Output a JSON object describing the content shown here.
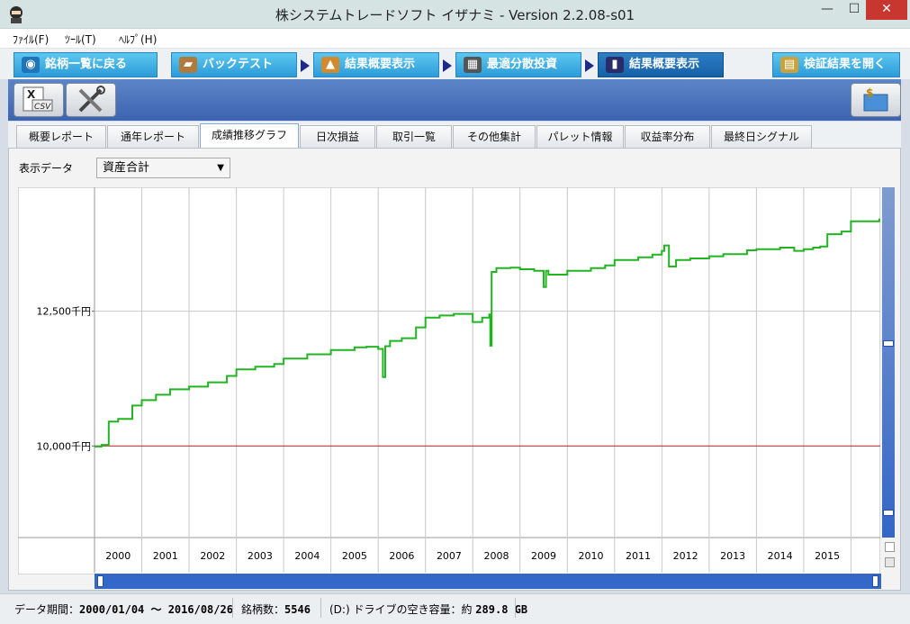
{
  "window": {
    "title": "株システムトレードソフト イザナミ - Version 2.2.08-s01",
    "minimize": "—",
    "maximize": "☐",
    "close": "✕"
  },
  "menu": [
    "ﾌｧｲﾙ(F)",
    "ﾂｰﾙ(T)",
    "ﾍﾙﾌﾟ(H)"
  ],
  "nav": {
    "items": [
      {
        "label": "銘柄一覧に戻る",
        "icon": "eye-icon"
      },
      {
        "label": "バックテスト",
        "icon": "bag-icon"
      },
      {
        "label": "結果概要表示",
        "icon": "hand-chart-icon"
      },
      {
        "label": "最適分散投資",
        "icon": "calculator-icon"
      },
      {
        "label": "結果概要表示",
        "icon": "bar-chart-icon",
        "active": true
      },
      {
        "label": "検証結果を開く",
        "icon": "open-folder-icon"
      }
    ]
  },
  "toolbar": {
    "csv_label": "CSV",
    "tools_icon": "tools-icon",
    "money_icon": "money-box-icon"
  },
  "subtabs": [
    "概要レポート",
    "通年レポート",
    "成績推移グラフ",
    "日次損益",
    "取引一覧",
    "その他集計",
    "パレット情報",
    "収益率分布",
    "最終日シグナル"
  ],
  "active_subtab": "成績推移グラフ",
  "display": {
    "label": "表示データ",
    "selected": "資産合計"
  },
  "chart_data": {
    "type": "line",
    "y_labels": [
      "12,500千円",
      "10,000千円"
    ],
    "y_ticks": [
      12500,
      10000
    ],
    "x_labels": [
      "2000",
      "2001",
      "2002",
      "2003",
      "2004",
      "2005",
      "2006",
      "2007",
      "2008",
      "2009",
      "2010",
      "2011",
      "2012",
      "2013",
      "2014",
      "2015"
    ],
    "baseline": 10000,
    "ylim": [
      8300,
      14800
    ],
    "series": [
      {
        "color": "#22b422",
        "x": [
          2000.0,
          2000.15,
          2000.3,
          2000.5,
          2000.8,
          2001.0,
          2001.3,
          2001.6,
          2002.0,
          2002.4,
          2002.8,
          2003.0,
          2003.4,
          2003.8,
          2004.0,
          2004.5,
          2005.0,
          2005.5,
          2005.75,
          2006.0,
          2006.1,
          2006.15,
          2006.25,
          2006.5,
          2006.8,
          2007.0,
          2007.3,
          2007.6,
          2008.0,
          2008.2,
          2008.35,
          2008.37,
          2008.4,
          2008.5,
          2008.8,
          2009.0,
          2009.3,
          2009.5,
          2009.55,
          2009.6,
          2010.0,
          2010.5,
          2010.8,
          2011.0,
          2011.5,
          2011.8,
          2012.0,
          2012.05,
          2012.15,
          2012.3,
          2012.6,
          2013.0,
          2013.3,
          2013.8,
          2014.0,
          2014.5,
          2014.8,
          2015.0,
          2015.2,
          2015.35,
          2015.5,
          2015.8,
          2016.0,
          2016.6
        ],
        "y": [
          9990,
          10020,
          10450,
          10500,
          10750,
          10850,
          10950,
          11050,
          11100,
          11180,
          11300,
          11420,
          11470,
          11520,
          11620,
          11700,
          11780,
          11830,
          11840,
          11800,
          11280,
          11850,
          11950,
          12000,
          12200,
          12380,
          12420,
          12450,
          12300,
          12380,
          12440,
          11860,
          13230,
          13300,
          13310,
          13280,
          13250,
          12950,
          13250,
          13180,
          13250,
          13300,
          13350,
          13450,
          13500,
          13550,
          13620,
          13720,
          13330,
          13450,
          13480,
          13520,
          13560,
          13630,
          13650,
          13680,
          13620,
          13650,
          13680,
          13700,
          13930,
          13980,
          14170,
          14220
        ]
      }
    ]
  },
  "status": {
    "period_label": "データ期間：",
    "period_value": "2000/01/04 ～ 2016/08/26",
    "count_label": "銘柄数：",
    "count_value": "5546",
    "drive_label": "(D:) ドライブの空き容量：約",
    "drive_value": "289.8 GB"
  }
}
